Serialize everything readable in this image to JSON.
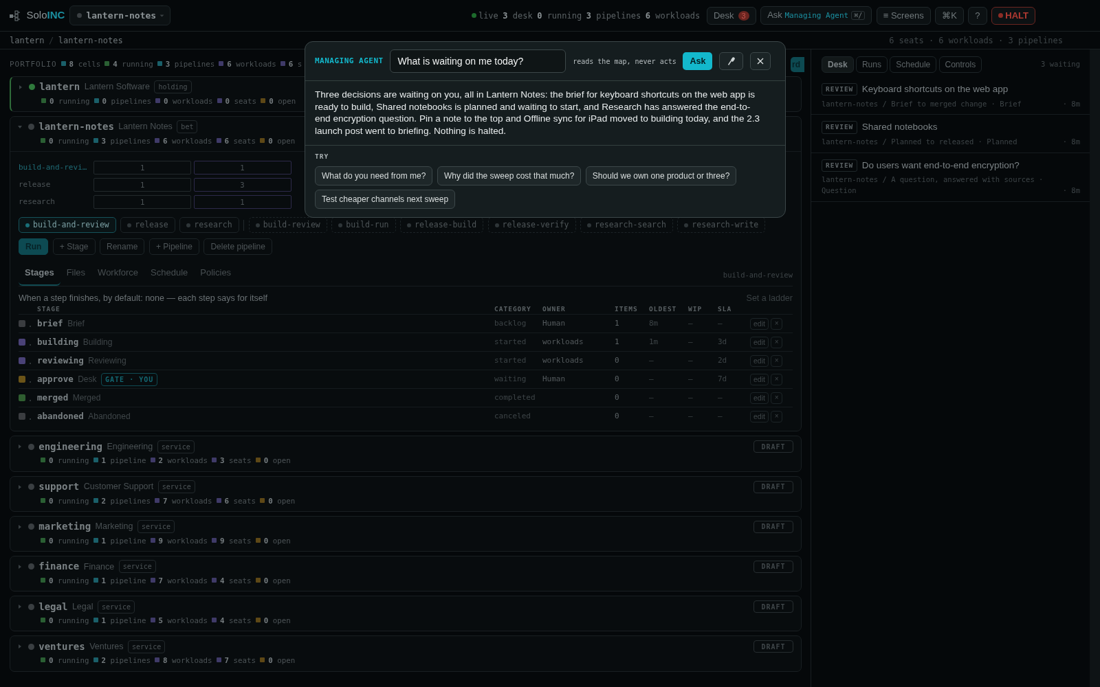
{
  "topbar": {
    "logo_text": "Solo",
    "logo_accent": "INC",
    "project_chip": "lantern-notes",
    "live_label": "live",
    "stats": [
      {
        "count": "3",
        "label": "desk"
      },
      {
        "count": "0",
        "label": "running"
      },
      {
        "count": "3",
        "label": "pipelines"
      },
      {
        "count": "6",
        "label": "workloads"
      }
    ],
    "desk_button": {
      "label": "Desk",
      "badge": "3"
    },
    "ask_button": {
      "label": "Ask",
      "agent": "Managing Agent",
      "shortcut": "⌘/"
    },
    "screens_button": {
      "icon": "≡",
      "label": "Screens"
    },
    "command_button": "⌘K",
    "help_button": "?",
    "halt_button": "HALT"
  },
  "breadcrumb": {
    "items": [
      "lantern",
      "lantern-notes"
    ],
    "separator": "/",
    "summary": "6 seats · 6 workloads · 3 pipelines"
  },
  "portfolio": {
    "label": "PORTFOLIO",
    "action_button": "rd",
    "stats": [
      {
        "count": "8",
        "label": "cells",
        "kind": "pipelines"
      },
      {
        "count": "4",
        "label": "running",
        "kind": "running"
      },
      {
        "count": "3",
        "label": "pipelines",
        "kind": "pipelines"
      },
      {
        "count": "6",
        "label": "workloads",
        "kind": "workloads"
      },
      {
        "count": "6",
        "label": "s",
        "kind": "seats"
      }
    ]
  },
  "cells": [
    {
      "key": "lantern",
      "name": "Lantern Software",
      "tag": "holding",
      "expanded": false,
      "selected": true,
      "color": "#2f7a3c",
      "stats": [
        {
          "count": "0",
          "label": "running",
          "kind": "running"
        },
        {
          "count": "0",
          "label": "pipelines",
          "kind": "pipelines"
        },
        {
          "count": "0",
          "label": "workloads",
          "kind": "workloads"
        },
        {
          "count": "0",
          "label": "seats",
          "kind": "seats"
        },
        {
          "count": "0",
          "label": "open",
          "kind": "open"
        }
      ]
    },
    {
      "key": "lantern-notes",
      "name": "Lantern Notes",
      "tag": "bet",
      "expanded": true,
      "selected": false,
      "color": "#3a3f42",
      "stats": [
        {
          "count": "0",
          "label": "running",
          "kind": "running"
        },
        {
          "count": "3",
          "label": "pipelines",
          "kind": "pipelines"
        },
        {
          "count": "6",
          "label": "workloads",
          "kind": "workloads"
        },
        {
          "count": "6",
          "label": "seats",
          "kind": "seats"
        },
        {
          "count": "0",
          "label": "open",
          "kind": "open"
        }
      ],
      "detail": {
        "matrix": [
          {
            "label": "build-and-revi…",
            "selected": true,
            "cells": [
              {
                "value": "1",
                "kind": "plain"
              },
              {
                "value": "1",
                "kind": "active"
              }
            ]
          },
          {
            "label": "release",
            "selected": false,
            "cells": [
              {
                "value": "1",
                "kind": "plain"
              },
              {
                "value": "3",
                "kind": "active"
              }
            ]
          },
          {
            "label": "research",
            "selected": false,
            "cells": [
              {
                "value": "1",
                "kind": "plain"
              },
              {
                "value": "1",
                "kind": "active"
              }
            ]
          }
        ],
        "chips": [
          {
            "label": "build-and-review",
            "kind": "pipeline",
            "selected": true
          },
          {
            "label": "release",
            "kind": "pipeline",
            "selected": false
          },
          {
            "label": "research",
            "kind": "pipeline",
            "selected": false
          },
          {
            "label": "build-review",
            "kind": "step",
            "selected": false
          },
          {
            "label": "build-run",
            "kind": "step",
            "selected": false
          },
          {
            "label": "release-build",
            "kind": "step",
            "selected": false
          },
          {
            "label": "release-verify",
            "kind": "step",
            "selected": false
          },
          {
            "label": "research-search",
            "kind": "step",
            "selected": false
          },
          {
            "label": "research-write",
            "kind": "step",
            "selected": false
          }
        ],
        "actions": [
          {
            "label": "Run",
            "kind": "primary"
          },
          {
            "label": "+ Stage",
            "kind": "secondary"
          },
          {
            "label": "Rename",
            "kind": "secondary"
          },
          {
            "label": "+ Pipeline",
            "kind": "secondary"
          },
          {
            "label": "Delete pipeline",
            "kind": "secondary"
          }
        ],
        "tabs": [
          {
            "label": "Stages",
            "selected": true
          },
          {
            "label": "Files",
            "selected": false
          },
          {
            "label": "Workforce",
            "selected": false
          },
          {
            "label": "Schedule",
            "selected": false
          },
          {
            "label": "Policies",
            "selected": false
          }
        ],
        "tab_context": "build-and-review",
        "default_line": "When a step finishes, by default:  none — each step says for itself",
        "ladder_link": "Set a ladder",
        "columns": [
          "STAGE",
          "CATEGORY",
          "OWNER",
          "ITEMS",
          "OLDEST",
          "WIP",
          "SLA"
        ],
        "rows": [
          {
            "color": "#3a3d40",
            "key": "brief",
            "name": "Brief",
            "category": "backlog",
            "owner": "Human",
            "items": "1",
            "oldest": "8m",
            "wip": "—",
            "sla": "—",
            "actions": [
              "edit",
              "×"
            ]
          },
          {
            "color": "#4a4277",
            "key": "building",
            "name": "Building",
            "category": "started",
            "owner": "workloads",
            "items": "1",
            "oldest": "1m",
            "wip": "—",
            "sla": "3d",
            "actions": [
              "edit",
              "×"
            ]
          },
          {
            "color": "#4a4277",
            "key": "reviewing",
            "name": "Reviewing",
            "category": "started",
            "owner": "workloads",
            "items": "0",
            "oldest": "—",
            "wip": "—",
            "sla": "2d",
            "actions": [
              "edit",
              "×"
            ]
          },
          {
            "color": "#6b5418",
            "key": "approve",
            "name": "Desk",
            "badge": "GATE · YOU",
            "category": "waiting",
            "owner": "Human",
            "items": "0",
            "oldest": "—",
            "wip": "—",
            "sla": "7d",
            "actions": [
              "edit",
              "×"
            ]
          },
          {
            "color": "#2f5e30",
            "key": "merged",
            "name": "Merged",
            "category": "completed",
            "items": "0",
            "oldest": "—",
            "wip": "—",
            "sla": "—",
            "actions": [
              "edit",
              "×"
            ]
          },
          {
            "color": "#3a3d40",
            "key": "abandoned",
            "name": "Abandoned",
            "category": "canceled",
            "items": "0",
            "oldest": "—",
            "wip": "—",
            "sla": "—",
            "actions": [
              "edit",
              "×"
            ]
          }
        ]
      }
    },
    {
      "key": "engineering",
      "name": "Engineering",
      "tag": "service",
      "expanded": false,
      "selected": false,
      "color": "#3a3f42",
      "button": "DRAFT",
      "stats": [
        {
          "count": "0",
          "label": "running",
          "kind": "running"
        },
        {
          "count": "1",
          "label": "pipeline",
          "kind": "pipelines"
        },
        {
          "count": "2",
          "label": "workloads",
          "kind": "workloads"
        },
        {
          "count": "3",
          "label": "seats",
          "kind": "seats"
        },
        {
          "count": "0",
          "label": "open",
          "kind": "open"
        }
      ]
    },
    {
      "key": "support",
      "name": "Customer Support",
      "tag": "service",
      "expanded": false,
      "selected": false,
      "color": "#3a3f42",
      "button": "DRAFT",
      "stats": [
        {
          "count": "0",
          "label": "running",
          "kind": "running"
        },
        {
          "count": "2",
          "label": "pipelines",
          "kind": "pipelines"
        },
        {
          "count": "7",
          "label": "workloads",
          "kind": "workloads"
        },
        {
          "count": "6",
          "label": "seats",
          "kind": "seats"
        },
        {
          "count": "0",
          "label": "open",
          "kind": "open"
        }
      ]
    },
    {
      "key": "marketing",
      "name": "Marketing",
      "tag": "service",
      "expanded": false,
      "selected": false,
      "color": "#3a3f42",
      "button": "DRAFT",
      "stats": [
        {
          "count": "0",
          "label": "running",
          "kind": "running"
        },
        {
          "count": "1",
          "label": "pipeline",
          "kind": "pipelines"
        },
        {
          "count": "9",
          "label": "workloads",
          "kind": "workloads"
        },
        {
          "count": "9",
          "label": "seats",
          "kind": "seats"
        },
        {
          "count": "0",
          "label": "open",
          "kind": "open"
        }
      ]
    },
    {
      "key": "finance",
      "name": "Finance",
      "tag": "service",
      "expanded": false,
      "selected": false,
      "color": "#3a3f42",
      "button": "DRAFT",
      "stats": [
        {
          "count": "0",
          "label": "running",
          "kind": "running"
        },
        {
          "count": "1",
          "label": "pipeline",
          "kind": "pipelines"
        },
        {
          "count": "7",
          "label": "workloads",
          "kind": "workloads"
        },
        {
          "count": "4",
          "label": "seats",
          "kind": "seats"
        },
        {
          "count": "0",
          "label": "open",
          "kind": "open"
        }
      ]
    },
    {
      "key": "legal",
      "name": "Legal",
      "tag": "service",
      "expanded": false,
      "selected": false,
      "color": "#3a3f42",
      "button": "DRAFT",
      "stats": [
        {
          "count": "0",
          "label": "running",
          "kind": "running"
        },
        {
          "count": "1",
          "label": "pipeline",
          "kind": "pipelines"
        },
        {
          "count": "5",
          "label": "workloads",
          "kind": "workloads"
        },
        {
          "count": "4",
          "label": "seats",
          "kind": "seats"
        },
        {
          "count": "0",
          "label": "open",
          "kind": "open"
        }
      ]
    },
    {
      "key": "ventures",
      "name": "Ventures",
      "tag": "service",
      "expanded": false,
      "selected": false,
      "color": "#3a3f42",
      "button": "DRAFT",
      "stats": [
        {
          "count": "0",
          "label": "running",
          "kind": "running"
        },
        {
          "count": "2",
          "label": "pipelines",
          "kind": "pipelines"
        },
        {
          "count": "8",
          "label": "workloads",
          "kind": "workloads"
        },
        {
          "count": "7",
          "label": "seats",
          "kind": "seats"
        },
        {
          "count": "0",
          "label": "open",
          "kind": "open"
        }
      ]
    }
  ],
  "side_panel": {
    "tabs": [
      {
        "label": "Desk",
        "selected": true
      },
      {
        "label": "Runs",
        "selected": false
      },
      {
        "label": "Schedule",
        "selected": false
      },
      {
        "label": "Controls",
        "selected": false
      }
    ],
    "count": "3 waiting",
    "items": [
      {
        "tag": "REVIEW",
        "title": "Keyboard shortcuts on the web app",
        "meta": "lantern-notes / Brief to merged change · Brief",
        "time": "· 8m"
      },
      {
        "tag": "REVIEW",
        "title": "Shared notebooks",
        "meta": "lantern-notes / Planned to released · Planned",
        "time": "· 8m"
      },
      {
        "tag": "REVIEW",
        "title": "Do users want end-to-end encryption?",
        "meta": "lantern-notes / A question, answered with sources · Question",
        "time": "· 8m"
      }
    ]
  },
  "agent_dialog": {
    "title": "MANAGING AGENT",
    "question": "What is waiting on me today?",
    "hint": "reads the map, never acts",
    "ask_button": "Ask",
    "answer": "Three decisions are waiting on you, all in Lantern Notes: the brief for keyboard shortcuts on the web app is ready to build, Shared notebooks is planned and waiting to start, and Research has answered the end-to-end encryption question. Pin a note to the top and Offline sync for iPad moved to building today, and the 2.3 launch post went to briefing. Nothing is halted.",
    "try_label": "TRY",
    "suggestions": [
      "What do you need from me?",
      "Why did the sweep cost that much?",
      "Should we own one product or three?",
      "Test cheaper channels next sweep"
    ]
  }
}
